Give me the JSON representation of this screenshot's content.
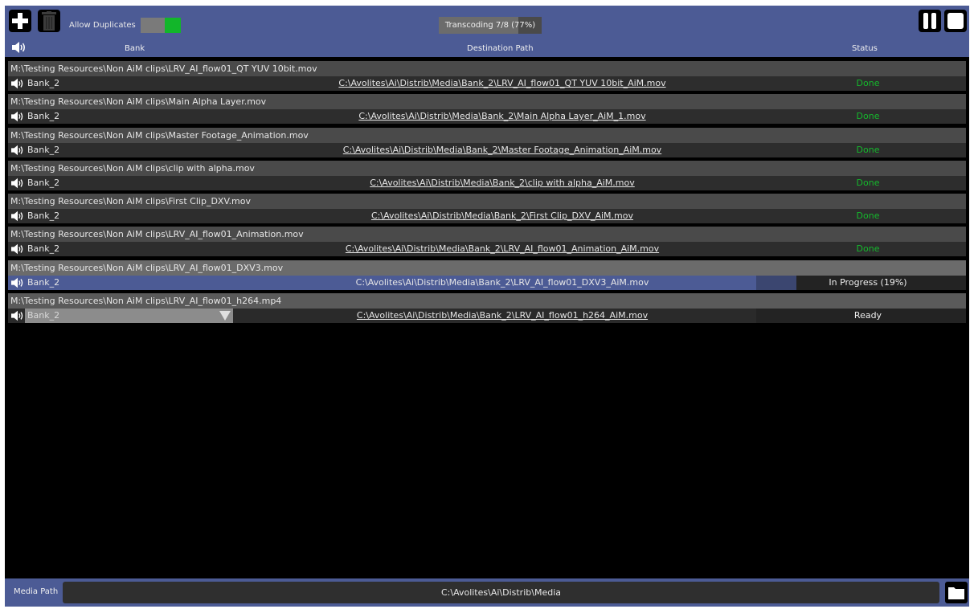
{
  "toolbar": {
    "allow_duplicates_label": "Allow Duplicates",
    "allow_duplicates_on": true,
    "transcoding_status": "Transcoding 7/8 (77%)",
    "transcoding_progress": 0.77,
    "add_icon": "plus-icon",
    "delete_icon": "trash-icon",
    "pause_icon": "pause-icon",
    "stop_icon": "stop-icon"
  },
  "columns": {
    "bank": "Bank",
    "destination": "Destination Path",
    "status": "Status"
  },
  "items": [
    {
      "source": "M:\\Testing Resources\\Non AiM clips\\LRV_AI_flow01_QT YUV 10bit.mov",
      "bank": "Bank_2",
      "destination": "C:\\Avolites\\Ai\\Distrib\\Media\\Bank_2\\LRV_AI_flow01_QT YUV 10bit_AiM.mov",
      "status": "Done"
    },
    {
      "source": "M:\\Testing Resources\\Non AiM clips\\Main Alpha Layer.mov",
      "bank": "Bank_2",
      "destination": "C:\\Avolites\\Ai\\Distrib\\Media\\Bank_2\\Main Alpha Layer_AiM_1.mov",
      "status": "Done"
    },
    {
      "source": "M:\\Testing Resources\\Non AiM clips\\Master Footage_Animation.mov",
      "bank": "Bank_2",
      "destination": "C:\\Avolites\\Ai\\Distrib\\Media\\Bank_2\\Master Footage_Animation_AiM.mov",
      "status": "Done"
    },
    {
      "source": "M:\\Testing Resources\\Non AiM clips\\clip with alpha.mov",
      "bank": "Bank_2",
      "destination": "C:\\Avolites\\Ai\\Distrib\\Media\\Bank_2\\clip with alpha_AiM.mov",
      "status": "Done"
    },
    {
      "source": "M:\\Testing Resources\\Non AiM clips\\First Clip_DXV.mov",
      "bank": "Bank_2",
      "destination": "C:\\Avolites\\Ai\\Distrib\\Media\\Bank_2\\First Clip_DXV_AiM.mov",
      "status": "Done"
    },
    {
      "source": "M:\\Testing Resources\\Non AiM clips\\LRV_AI_flow01_Animation.mov",
      "bank": "Bank_2",
      "destination": "C:\\Avolites\\Ai\\Distrib\\Media\\Bank_2\\LRV_AI_flow01_Animation_AiM.mov",
      "status": "Done"
    },
    {
      "source": "M:\\Testing Resources\\Non AiM clips\\LRV_AI_flow01_DXV3.mov",
      "bank": "Bank_2",
      "destination": "C:\\Avolites\\Ai\\Distrib\\Media\\Bank_2\\LRV_AI_flow01_DXV3_AiM.mov",
      "status": "In Progress (19%)"
    },
    {
      "source": "M:\\Testing Resources\\Non AiM clips\\LRV_AI_flow01_h264.mp4",
      "bank": "Bank_2",
      "destination": "C:\\Avolites\\Ai\\Distrib\\Media\\Bank_2\\LRV_AI_flow01_h264_AiM.mov",
      "status": "Ready"
    }
  ],
  "footer": {
    "media_path_label": "Media Path",
    "media_path_value": "C:\\Avolites\\Ai\\Distrib\\Media",
    "folder_icon": "folder-icon"
  },
  "colors": {
    "accent": "#4c5b95",
    "toggle_on": "#12b62a",
    "done": "#15b82d"
  }
}
